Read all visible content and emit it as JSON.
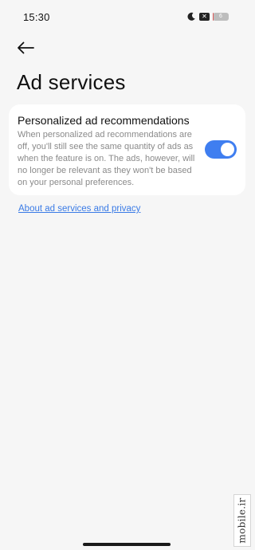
{
  "status_bar": {
    "time": "15:30",
    "icons": [
      "moon-icon",
      "sim-card-icon",
      "battery-icon"
    ],
    "sim_label": "✕",
    "battery_level": "6",
    "battery_fraction": 0.06,
    "battery_color": "#e05b5b"
  },
  "header": {
    "back_icon": "arrow-left-icon",
    "title": "Ad services"
  },
  "setting": {
    "title": "Personalized ad recommendations",
    "description": "When personalized ad recommendations are off, you'll still see the same quantity of ads as when the feature is on. The ads, however, will no longer be relevant as they won't be based on your personal preferences.",
    "enabled": true,
    "toggle_color": "#3f7ef0"
  },
  "link": {
    "label": "About ad services and privacy",
    "color": "#3a7be6"
  },
  "watermark": {
    "text": "mobile.ir"
  }
}
